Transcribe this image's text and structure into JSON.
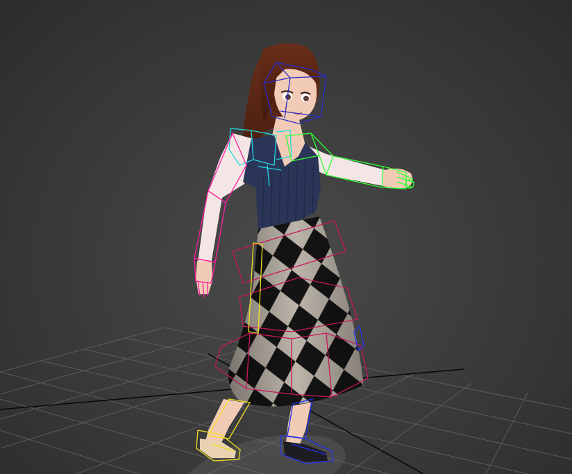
{
  "viewport": {
    "background_color": "#3c3c3c",
    "grid_color": "#5a5a5a",
    "axis_color": "#0a0a0a"
  },
  "character": {
    "hair_color": "#5a2a18",
    "skin_color": "#f2cbb7",
    "top_color": "#2b3558",
    "sleeve_color": "#f3e6e4",
    "skirt_dark": "#151515",
    "skirt_light": "#b8b0a6",
    "shoe_color": "#1c1c22"
  },
  "rig": {
    "spine_color": "#c8185a",
    "left_arm_color": "#ff1fa0",
    "right_arm_color": "#33ff33",
    "clavicle_color": "#22d8e0",
    "head_color": "#2a2ac8",
    "left_leg_color": "#f0e020",
    "right_leg_color": "#2233ee"
  }
}
